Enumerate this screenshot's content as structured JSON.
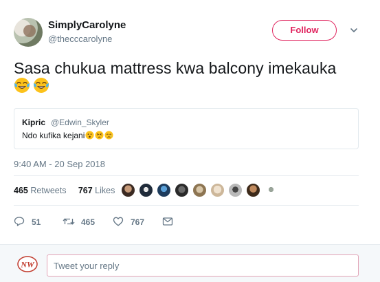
{
  "author": {
    "display_name": "SimplyCarolyne",
    "handle": "@thecccarolyne"
  },
  "follow_button": {
    "label": "Follow",
    "color": "#e0245e"
  },
  "tweet": {
    "text": "Sasa chukua mattress kwa balcony imekauka",
    "emojis": [
      "face-with-tears-of-joy-icon",
      "face-with-tears-of-joy-icon"
    ]
  },
  "quoted_tweet": {
    "name": "Kipric",
    "handle": "@Edwin_Skyler",
    "text": "Ndo kufika kejani",
    "emojis": [
      "hushed-face-icon",
      "tired-face-icon",
      "crying-face-icon"
    ]
  },
  "timestamp": "9:40 AM - 20 Sep 2018",
  "stats": {
    "retweets_count": "465",
    "retweets_label": "Retweets",
    "likes_count": "767",
    "likes_label": "Likes"
  },
  "likers": [
    "avatar",
    "avatar",
    "avatar",
    "avatar",
    "avatar",
    "avatar",
    "avatar",
    "avatar",
    "avatar"
  ],
  "actions": {
    "replies": "51",
    "retweets": "465",
    "likes": "767"
  },
  "reply": {
    "placeholder": "Tweet your reply",
    "logo_text": "NW"
  }
}
